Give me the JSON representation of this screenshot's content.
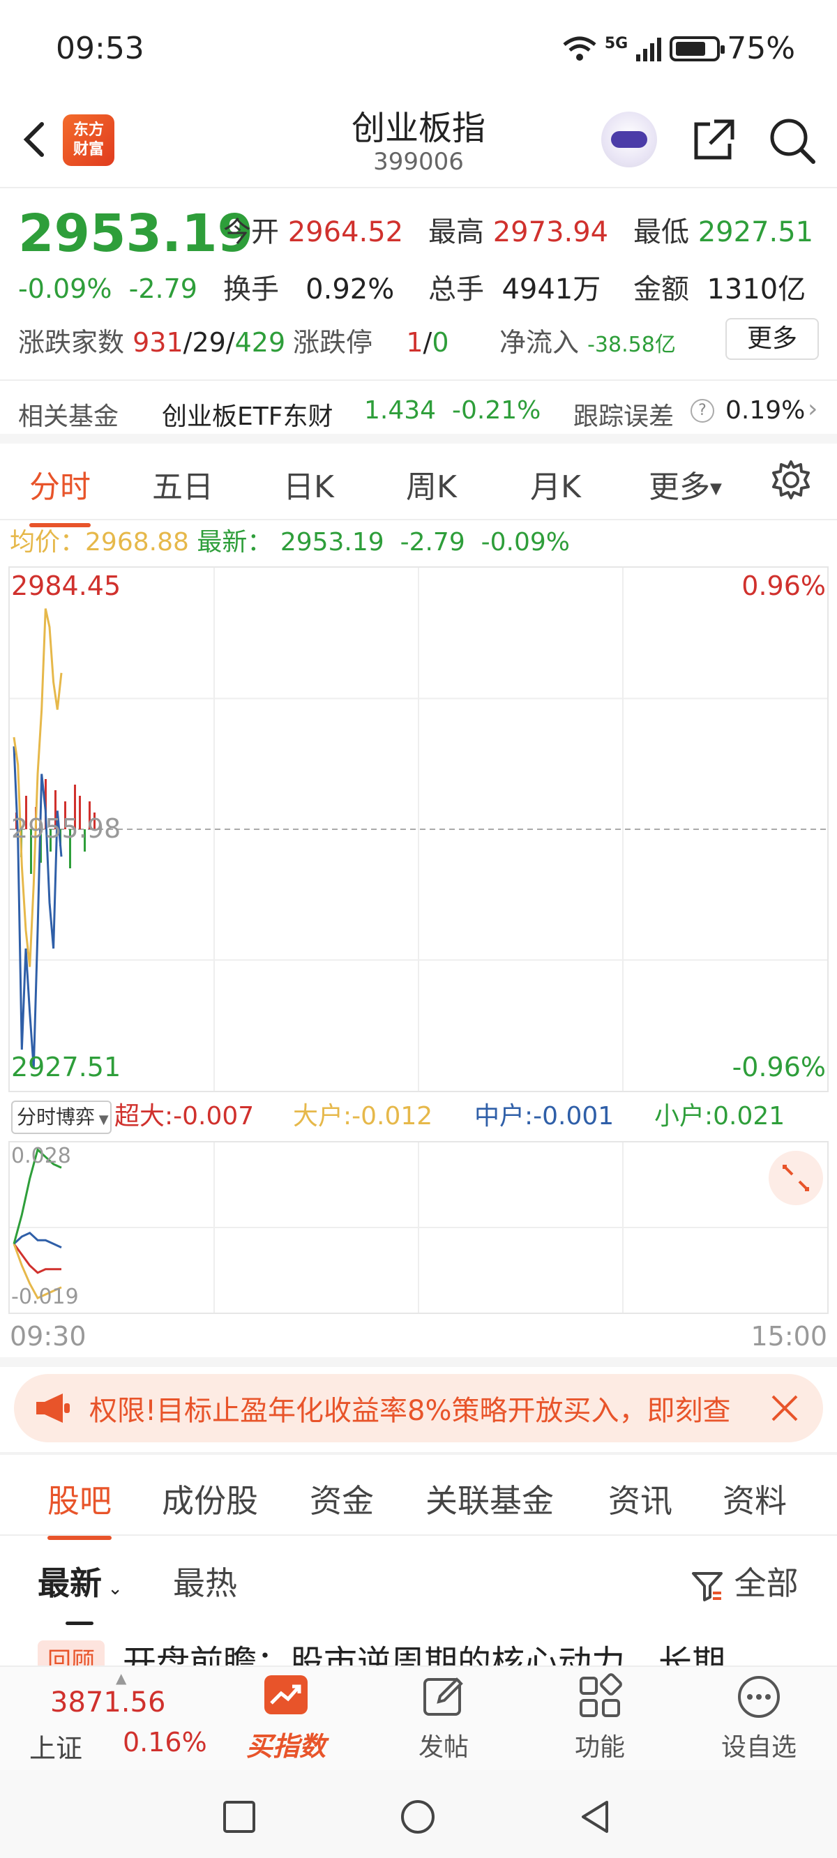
{
  "status_bar": {
    "time": "09:53",
    "network": "5G",
    "battery": "75%"
  },
  "header": {
    "title": "创业板指",
    "code": "399006",
    "logo_text": "东方财富"
  },
  "quote": {
    "price": "2953.19",
    "change_pct": "-0.09%",
    "change": "-2.79",
    "open_label": "今开",
    "open": "2964.52",
    "high_label": "最高",
    "high": "2973.94",
    "low_label": "最低",
    "low": "2927.51",
    "turnover_label": "换手",
    "turnover": "0.92%",
    "volume_label": "总手",
    "volume": "4941万",
    "amount_label": "金额",
    "amount": "1310亿",
    "breadth_label": "涨跌家数",
    "up": "931",
    "flat": "29",
    "down": "429",
    "limit_label": "涨跌停",
    "limit_up": "1",
    "limit_down": "0",
    "inflow_label": "净流入",
    "inflow": "-38.58亿",
    "more_button": "更多"
  },
  "fund": {
    "label": "相关基金",
    "name": "创业板ETF东财",
    "price": "1.434",
    "change": "-0.21%",
    "error_label": "跟踪误差",
    "error": "0.19%"
  },
  "chart_tabs": [
    "分时",
    "五日",
    "日K",
    "周K",
    "月K",
    "更多"
  ],
  "avg_line": {
    "avg_label": "均价：",
    "avg": "2968.88",
    "latest_label": "最新：",
    "latest": "2953.19",
    "chg": "-2.79",
    "pct": "-0.09%"
  },
  "chart_data": [
    {
      "type": "line",
      "title": "",
      "x_range": [
        "09:30",
        "15:00"
      ],
      "ylim": [
        2927.51,
        2984.45
      ],
      "y_labels": {
        "top": "2984.45",
        "mid": "2955.98",
        "bottom": "2927.51"
      },
      "right_labels": {
        "top": "0.96%",
        "bottom": "-0.96%"
      },
      "series": [
        {
          "name": "",
          "color": "#2f5fa8",
          "values": [
            2965,
            2955,
            2932,
            2943,
            2936,
            2930,
            2945,
            2962,
            2958,
            2948,
            2943,
            2958,
            2953
          ]
        },
        {
          "name": "",
          "color": "#e6b84a",
          "values": [
            2966,
            2963,
            2952,
            2945,
            2941,
            2950,
            2962,
            2969,
            2980,
            2978,
            2972,
            2969,
            2973
          ]
        }
      ]
    },
    {
      "type": "line",
      "title": "",
      "ylim": [
        -0.019,
        0.028
      ],
      "y_labels": {
        "top": "0.028",
        "bottom": "-0.019"
      },
      "series": [
        {
          "name": "超大",
          "color": "#d0312d",
          "values": [
            0,
            -0.003,
            -0.006,
            -0.008,
            -0.007,
            -0.007,
            -0.007
          ]
        },
        {
          "name": "大户",
          "color": "#e6b84a",
          "values": [
            0,
            -0.006,
            -0.011,
            -0.015,
            -0.014,
            -0.013,
            -0.012
          ]
        },
        {
          "name": "中户",
          "color": "#2f5fa8",
          "values": [
            0,
            0.002,
            0.003,
            0.001,
            0.001,
            0.0,
            -0.001
          ]
        },
        {
          "name": "小户",
          "color": "#2e9e3a",
          "values": [
            0,
            0.008,
            0.018,
            0.026,
            0.024,
            0.022,
            0.021
          ]
        }
      ]
    }
  ],
  "flow": {
    "selector": "分时博弈",
    "super_label": "超大:",
    "super": "-0.007",
    "large_label": "大户:",
    "large": "-0.012",
    "mid_label": "中户:",
    "mid": "-0.001",
    "small_label": "小户:",
    "small": "0.021"
  },
  "time_axis": {
    "start": "09:30",
    "end": "15:00"
  },
  "promo": {
    "text": "权限!目标止盈年化收益率8%策略开放买入，即刻查"
  },
  "bottom_tabs": [
    "股吧",
    "成份股",
    "资金",
    "关联基金",
    "资讯",
    "资料"
  ],
  "sort": {
    "latest": "最新",
    "hot": "最热",
    "filter": "全部"
  },
  "post_peek": {
    "badge": "回顾",
    "text": "开盘前瞻：股市逆周期的核心动力，长期"
  },
  "nav": {
    "sse_value": "3871.56",
    "sse_label": "上证",
    "sse_pct": "0.16%",
    "buy": "买指数",
    "post": "发帖",
    "func": "功能",
    "fav": "设自选"
  },
  "colors": {
    "up": "#d0312d",
    "down": "#2e9e3a",
    "accent": "#e8542a"
  }
}
